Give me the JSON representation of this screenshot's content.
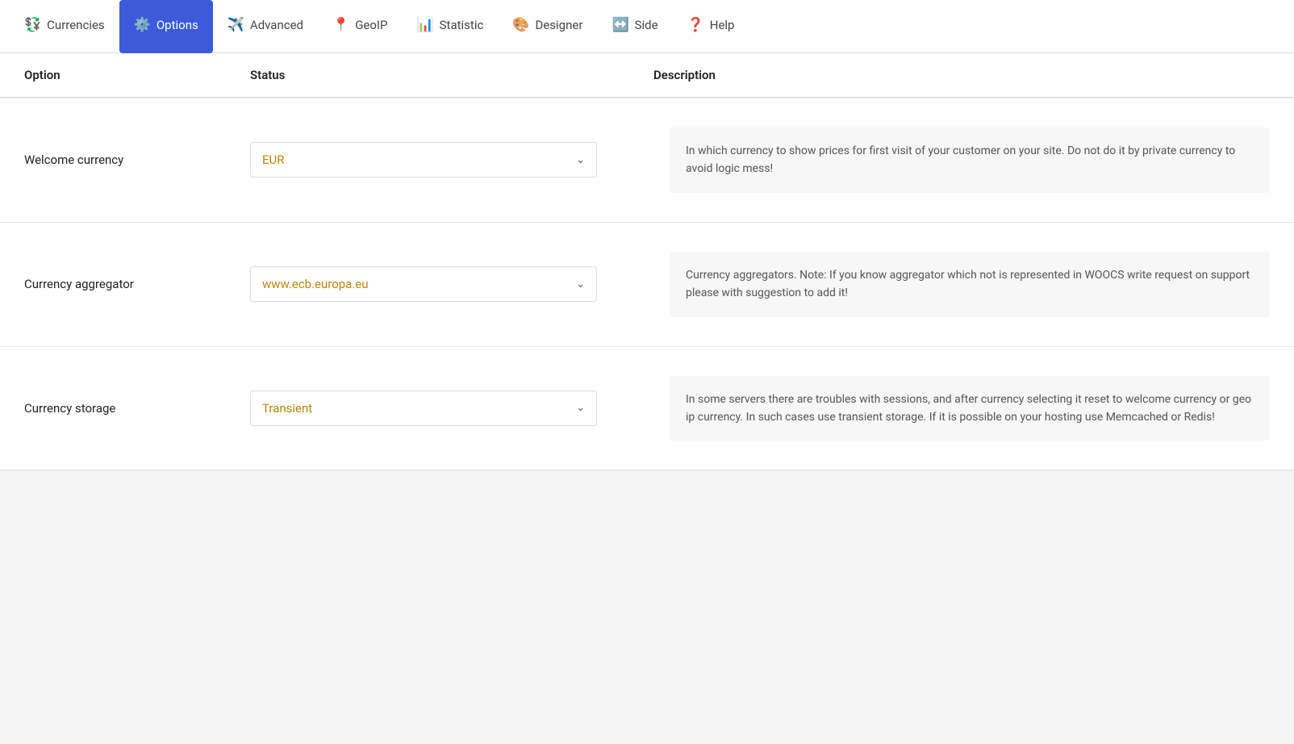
{
  "nav": {
    "items": [
      {
        "id": "currencies",
        "label": "Currencies",
        "icon": "💱",
        "active": false
      },
      {
        "id": "options",
        "label": "Options",
        "icon": "⚙️",
        "active": true
      },
      {
        "id": "advanced",
        "label": "Advanced",
        "icon": "✈️",
        "active": false
      },
      {
        "id": "geoip",
        "label": "GeoIP",
        "icon": "📍",
        "active": false
      },
      {
        "id": "statistic",
        "label": "Statistic",
        "icon": "📊",
        "active": false
      },
      {
        "id": "designer",
        "label": "Designer",
        "icon": "🎨",
        "active": false
      },
      {
        "id": "side",
        "label": "Side",
        "icon": "↔️",
        "active": false
      },
      {
        "id": "help",
        "label": "Help",
        "icon": "❓",
        "active": false
      }
    ]
  },
  "table": {
    "headers": {
      "option": "Option",
      "status": "Status",
      "description": "Description"
    },
    "rows": [
      {
        "id": "welcome-currency",
        "label": "Welcome currency",
        "value": "EUR",
        "description": "In which currency to show prices for first visit of your customer on your site. Do not do it by private currency to avoid logic mess!"
      },
      {
        "id": "currency-aggregator",
        "label": "Currency aggregator",
        "value": "www.ecb.europa.eu",
        "description": "Currency aggregators. Note: If you know aggregator which not is represented in WOOCS write request on support please with suggestion to add it!"
      },
      {
        "id": "currency-storage",
        "label": "Currency storage",
        "value": "Transient",
        "description": "In some servers there are troubles with sessions, and after currency selecting it reset to welcome currency or geo ip currency. In such cases use transient storage. If it is possible on your hosting use Memcached or Redis!"
      }
    ]
  }
}
